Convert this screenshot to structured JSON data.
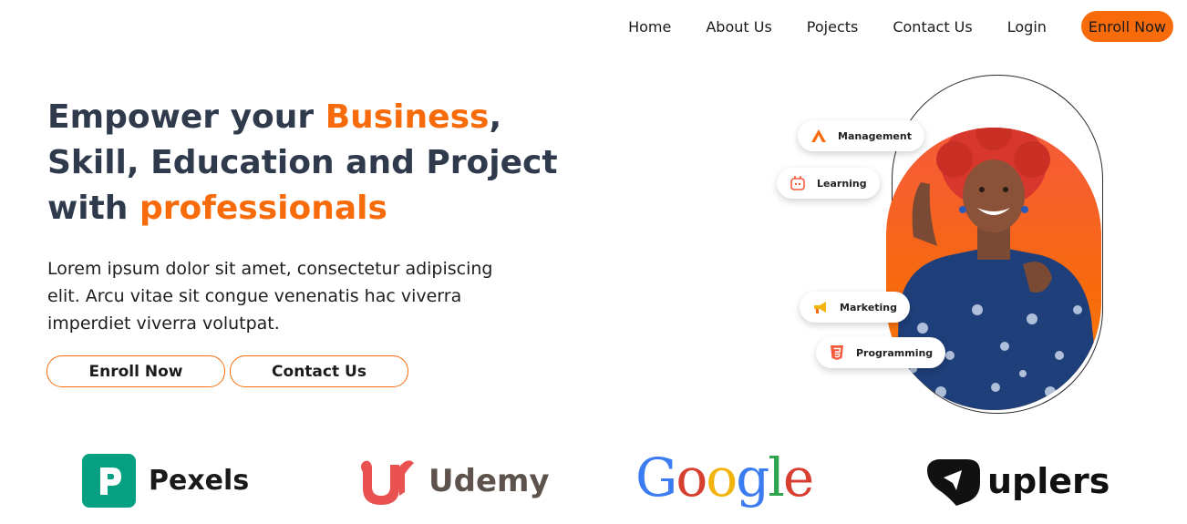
{
  "nav": {
    "links": [
      "Home",
      "About Us",
      "Pojects",
      "Contact Us",
      "Login"
    ],
    "cta": "Enroll Now"
  },
  "hero": {
    "title_part1": "Empower your ",
    "title_accent1": "Business",
    "title_part2": ", Skill, Education and Project with ",
    "title_accent2": "professionals",
    "description": "Lorem ipsum dolor sit amet, consectetur adipiscing elit. Arcu vitae sit congue venenatis hac viverra imperdiet viverra volutpat.",
    "buttons": {
      "enroll": "Enroll Now",
      "contact": "Contact Us"
    }
  },
  "chips": [
    {
      "label": "Management",
      "icon": "management-icon"
    },
    {
      "label": "Learning",
      "icon": "learning-icon"
    },
    {
      "label": "Marketing",
      "icon": "megaphone-icon"
    },
    {
      "label": "Programming",
      "icon": "css3-icon"
    }
  ],
  "partners": {
    "pexels": "Pexels",
    "udemy": "Udemy",
    "google": [
      "G",
      "o",
      "o",
      "g",
      "l",
      "e"
    ],
    "uplers": "uplers"
  },
  "colors": {
    "accent": "#f76b0a",
    "heading": "#2f3b4c",
    "pexels": "#05a081",
    "udemy": "#ea5252",
    "udemy_text": "#5e534c",
    "google": [
      "#3b7cf0",
      "#d73f31",
      "#f2b50f",
      "#3b7cf0",
      "#2ea44f",
      "#d73f31"
    ]
  }
}
